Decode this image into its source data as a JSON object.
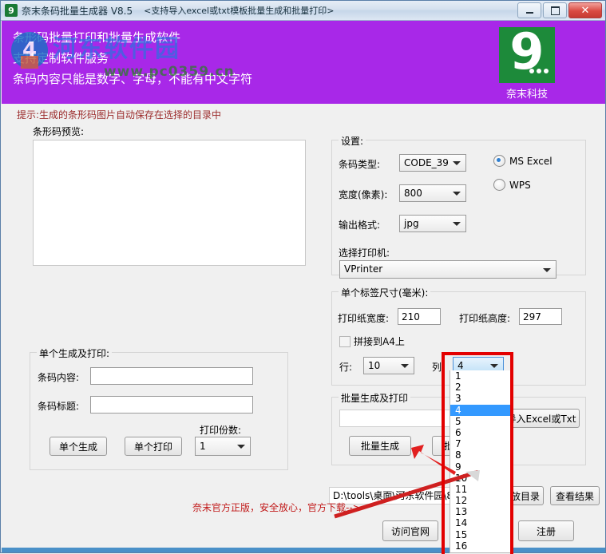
{
  "window": {
    "title": "奈末条码批量生成器 V8.5",
    "subtitle": "<支持导入excel或txt模板批量生成和批量打印>",
    "icon": "app-icon-9",
    "minimize_label": "最小化",
    "maximize_label": "最大化",
    "close_label": "✕"
  },
  "banner": {
    "line1": "条形码批量打印和批量生成软件",
    "line2": "支持定制软件服务",
    "line3": "条码内容只能是数字、字母，不能有中文字符",
    "logo_digit": "9",
    "logo_caption": "奈末科技",
    "background_color": "#a828e8",
    "logo_color": "#1d8a3a"
  },
  "watermark": {
    "badge": "4",
    "site_name": "河东软件园",
    "url": "www.pc0359.cn"
  },
  "hint": "提示:生成的条形码图片自动保存在选择的目录中",
  "preview": {
    "label": "条形码预览:"
  },
  "single": {
    "group_title": "单个生成及打印:",
    "content_label": "条码内容:",
    "content_value": "",
    "title_label": "条码标题:",
    "title_value": "",
    "copies_label": "打印份数:",
    "copies_value": "1",
    "generate_button": "单个生成",
    "print_button": "单个打印"
  },
  "settings": {
    "group_title": "设置:",
    "barcode_type_label": "条码类型:",
    "barcode_type_value": "CODE_39",
    "width_label": "宽度(像素):",
    "width_value": "800",
    "format_label": "输出格式:",
    "format_value": "jpg",
    "printer_label": "选择打印机:",
    "printer_value": "VPrinter",
    "office_options": [
      {
        "label": "MS  Excel",
        "selected": true
      },
      {
        "label": "WPS",
        "selected": false
      }
    ]
  },
  "label_size": {
    "group_title": "单个标签尺寸(毫米):",
    "paper_width_label": "打印纸宽度:",
    "paper_width_value": "210",
    "paper_height_label": "打印纸高度:",
    "paper_height_value": "297",
    "merge_a4_label": "拼接到A4上",
    "merge_a4_checked": false,
    "rows_label": "行:",
    "rows_value": "10",
    "cols_label": "列:",
    "cols_value": "4"
  },
  "cols_dropdown": {
    "open": true,
    "selected": "4",
    "options": [
      "1",
      "2",
      "3",
      "4",
      "5",
      "6",
      "7",
      "8",
      "9",
      "10",
      "11",
      "12",
      "13",
      "14",
      "15",
      "16"
    ],
    "highlight_color": "#3399ff"
  },
  "batch": {
    "group_title": "批量生成及打印",
    "file_value": "",
    "generate_button": "批量生成",
    "print_button": "批量打印",
    "import_button": "导入Excel或Txt"
  },
  "output": {
    "path_value": "D:\\tools\\桌面\\河东软件园\\8",
    "choose_dir_button": "存放目录",
    "view_result_button": "查看结果"
  },
  "footer": {
    "promo_text": "奈末官方正版，安全放心，官方下载-->",
    "visit_site_button": "访问官网",
    "register_button": "注册"
  }
}
